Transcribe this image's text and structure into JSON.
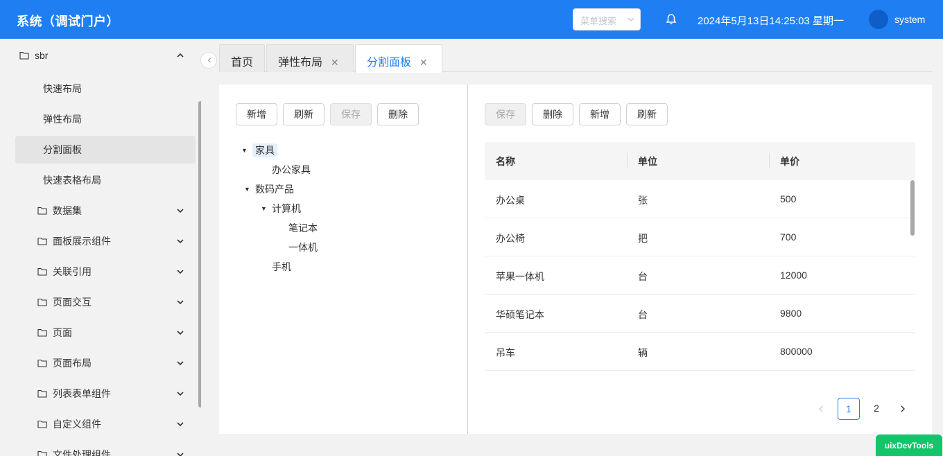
{
  "header": {
    "title": "系统（调试门户）",
    "menu_search_placeholder": "菜单搜索",
    "datetime": "2024年5月13日14:25:03 星期一",
    "username": "system",
    "accent_color": "#1f7ff2"
  },
  "sidebar": {
    "top": {
      "label": "sbr",
      "icon": "folder-icon",
      "expanded": true
    },
    "sub_items": [
      {
        "label": "快速布局"
      },
      {
        "label": "弹性布局"
      },
      {
        "label": "分割面板",
        "active": true
      },
      {
        "label": "快速表格布局"
      }
    ],
    "groups": [
      {
        "label": "数据集"
      },
      {
        "label": "面板展示组件"
      },
      {
        "label": "关联引用"
      },
      {
        "label": "页面交互"
      },
      {
        "label": "页面"
      },
      {
        "label": "页面布局"
      },
      {
        "label": "列表表单组件"
      },
      {
        "label": "自定义组件"
      },
      {
        "label": "文件处理组件"
      }
    ]
  },
  "tabs": [
    {
      "label": "首页",
      "closable": false
    },
    {
      "label": "弹性布局",
      "closable": true
    },
    {
      "label": "分割面板",
      "closable": true,
      "active": true
    }
  ],
  "left_panel": {
    "buttons": [
      {
        "label": "新增",
        "disabled": false
      },
      {
        "label": "刷新",
        "disabled": false
      },
      {
        "label": "保存",
        "disabled": true
      },
      {
        "label": "删除",
        "disabled": false
      }
    ],
    "tree": [
      {
        "label": "家具",
        "level": 0,
        "expanded": true,
        "selected": true
      },
      {
        "label": "办公家具",
        "level": 1
      },
      {
        "label": "数码产品",
        "level": 0,
        "expanded": true
      },
      {
        "label": "计算机",
        "level": 1,
        "expanded": true
      },
      {
        "label": "笔记本",
        "level": 2
      },
      {
        "label": "一体机",
        "level": 2
      },
      {
        "label": "手机",
        "level": 1
      }
    ]
  },
  "right_panel": {
    "buttons": [
      {
        "label": "保存",
        "disabled": true
      },
      {
        "label": "删除",
        "disabled": false
      },
      {
        "label": "新增",
        "disabled": false
      },
      {
        "label": "刷新",
        "disabled": false
      }
    ],
    "table": {
      "columns": [
        "名称",
        "单位",
        "单价"
      ],
      "rows": [
        [
          "办公桌",
          "张",
          "500"
        ],
        [
          "办公椅",
          "把",
          "700"
        ],
        [
          "苹果一体机",
          "台",
          "12000"
        ],
        [
          "华硕笔记本",
          "台",
          "9800"
        ],
        [
          "吊车",
          "辆",
          "800000"
        ]
      ]
    },
    "pagination": {
      "current": "1",
      "pages": [
        "1",
        "2"
      ]
    }
  },
  "devtools_label": "uixDevTools"
}
